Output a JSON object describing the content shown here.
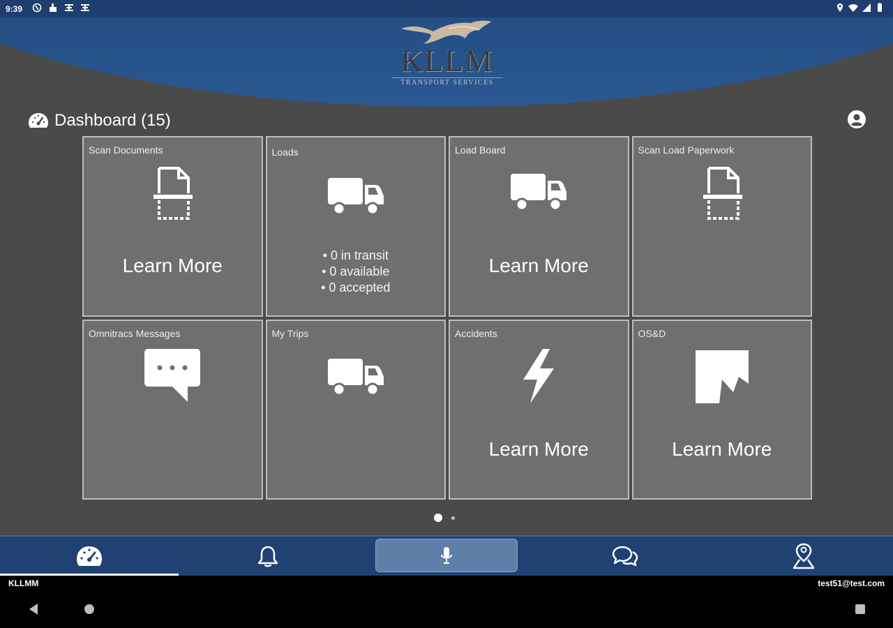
{
  "status_bar": {
    "time": "9:39",
    "left_icons": [
      "nfc-icon",
      "clipboard-icon",
      "calendar-icon",
      "calendar-icon"
    ],
    "right_icons": [
      "location-icon",
      "wifi-icon",
      "signal-icon",
      "battery-icon"
    ]
  },
  "header": {
    "logo_text": "KLLM",
    "logo_subtitle": "TRANSPORT SERVICES"
  },
  "dashboard": {
    "title": "Dashboard (15)",
    "title_icon": "speedometer-icon",
    "profile_icon": "user-circle-icon"
  },
  "tiles": [
    {
      "label": "Scan Documents",
      "icon": "scan-document-icon",
      "cta": "Learn More"
    },
    {
      "label": "Loads",
      "icon": "truck-icon",
      "stats": [
        "• 0 in transit",
        "• 0 available",
        "• 0 accepted"
      ]
    },
    {
      "label": "Load Board",
      "icon": "truck-icon",
      "cta": "Learn More"
    },
    {
      "label": "Scan Load Paperwork",
      "icon": "scan-document-icon"
    },
    {
      "label": "Omnitracs Messages",
      "icon": "chat-bubble-icon"
    },
    {
      "label": "My Trips",
      "icon": "truck-icon"
    },
    {
      "label": "Accidents",
      "icon": "lightning-icon",
      "cta": "Learn More"
    },
    {
      "label": "OS&D",
      "icon": "damaged-box-icon",
      "cta": "Learn More"
    }
  ],
  "pager": {
    "pages": 2,
    "active": 1
  },
  "bottom_nav": [
    {
      "icon": "speedometer-icon",
      "active": true
    },
    {
      "icon": "bell-icon",
      "active": false
    },
    {
      "icon": "microphone-icon",
      "active": false
    },
    {
      "icon": "chat-icon",
      "active": false
    },
    {
      "icon": "map-pin-person-icon",
      "active": false
    }
  ],
  "info_bar": {
    "left": "KLLMM",
    "right": "test51@test.com"
  },
  "colors": {
    "header_blue": "#1f4679",
    "nav_blue": "#1f4272",
    "tile_gray": "#6f6f6f",
    "background": "#4a4a4a"
  }
}
